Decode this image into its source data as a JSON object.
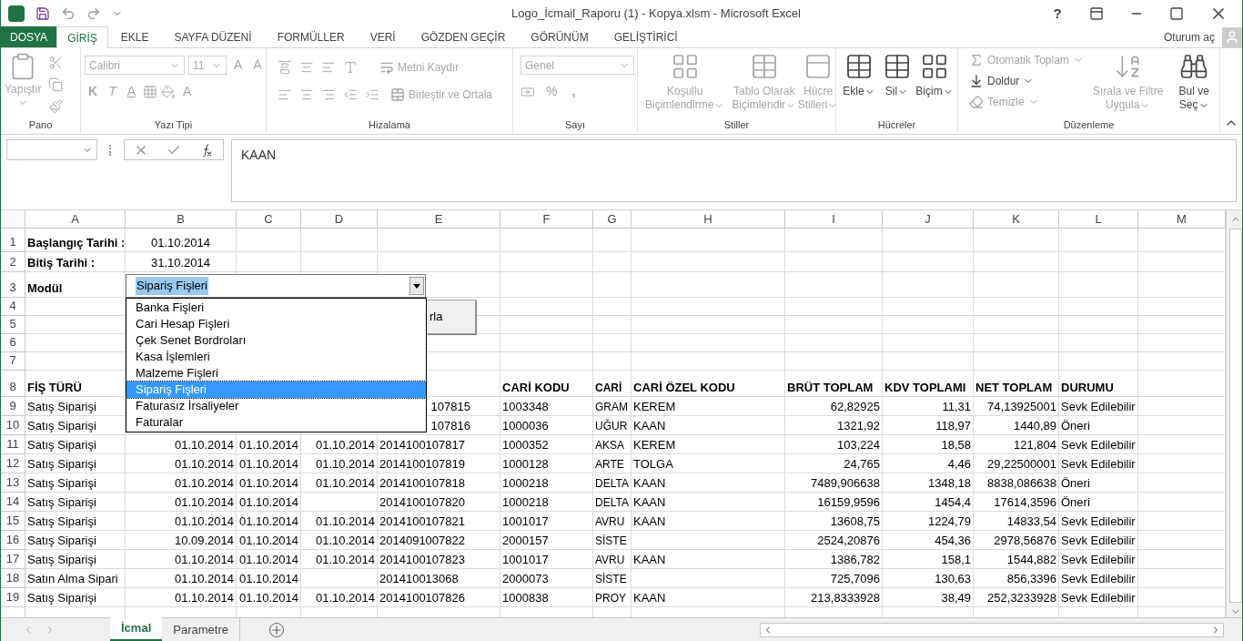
{
  "window": {
    "title": "Logo_İcmail_Raporu (1) - Kopya.xlsm - Microsoft Excel",
    "help": "?"
  },
  "ribbon_tabs": [
    {
      "label": "DOSYA",
      "kind": "file",
      "selected": false
    },
    {
      "label": "GİRİŞ",
      "kind": "tab",
      "selected": true
    },
    {
      "label": "EKLE",
      "kind": "tab",
      "selected": false
    },
    {
      "label": "SAYFA DÜZENİ",
      "kind": "tab",
      "selected": false
    },
    {
      "label": "FORMÜLLER",
      "kind": "tab",
      "selected": false
    },
    {
      "label": "VERİ",
      "kind": "tab",
      "selected": false
    },
    {
      "label": "GÖZDEN GEÇİR",
      "kind": "tab",
      "selected": false
    },
    {
      "label": "GÖRÜNÜM",
      "kind": "tab",
      "selected": false
    },
    {
      "label": "GELİŞTİRİCİ",
      "kind": "tab",
      "selected": false
    }
  ],
  "account": "Oturum aç",
  "ribbon": {
    "clipboard": {
      "name": "Pano",
      "paste": {
        "label": "Yapıştır",
        "disabled": true
      }
    },
    "font": {
      "name": "Yazı Tipi",
      "family": "Calibri",
      "size": "11",
      "grow": "A",
      "shrink": "A",
      "bold": "K",
      "italic": "T",
      "underline": "A",
      "text_color_button": "A",
      "disabled": true
    },
    "alignment": {
      "name": "Hizalama",
      "wrap": "Metni Kaydır",
      "merge": "Birleştir ve Ortala",
      "disabled": true
    },
    "number": {
      "name": "Sayı",
      "format": "Genel",
      "percent": "%",
      "comma": ",",
      "disabled": true
    },
    "styles": {
      "name": "Stiller",
      "items": [
        {
          "lines": [
            "Koşullu",
            "Biçimlendirme"
          ],
          "disabled": true
        },
        {
          "lines": [
            "Tablo Olarak",
            "Biçimlendir"
          ],
          "disabled": true
        },
        {
          "lines": [
            "Hücre",
            "Stilleri"
          ],
          "disabled": true
        }
      ]
    },
    "cells": {
      "name": "Hücreler",
      "items": [
        {
          "lines": [
            "Ekle"
          ],
          "disabled": false
        },
        {
          "lines": [
            "Sil"
          ],
          "disabled": false
        },
        {
          "lines": [
            "Biçim"
          ],
          "disabled": false
        }
      ]
    },
    "editing": {
      "name": "Düzenleme",
      "small": [
        {
          "label": "Otomatik Toplam",
          "disabled": true
        },
        {
          "label": "Doldur",
          "disabled": false
        },
        {
          "label": "Temizle",
          "disabled": true
        }
      ],
      "items": [
        {
          "lines": [
            "Sırala ve Filtre",
            "Uygula"
          ],
          "disabled": true
        },
        {
          "lines": [
            "Bul ve",
            "Seç"
          ],
          "disabled": false
        }
      ]
    }
  },
  "formula_bar": {
    "formula": "KAAN"
  },
  "columns": [
    "A",
    "B",
    "C",
    "D",
    "E",
    "F",
    "G",
    "H",
    "I",
    "J",
    "K",
    "L",
    "M"
  ],
  "rows": [
    {
      "number": "1",
      "kind": "form",
      "cells": {
        "A": "Başlangıç Tarihi :",
        "B": "01.10.2014"
      }
    },
    {
      "number": "2",
      "kind": "form",
      "cells": {
        "A": "Bitiş Tarihi :",
        "B": "31.10.2014"
      }
    },
    {
      "number": "3",
      "kind": "form",
      "cells": {
        "A": "Modül"
      }
    },
    {
      "number": "4",
      "kind": "data",
      "cells": {}
    },
    {
      "number": "5",
      "kind": "data",
      "cells": {}
    },
    {
      "number": "6",
      "kind": "data",
      "cells": {}
    },
    {
      "number": "7",
      "kind": "data",
      "cells": {}
    },
    {
      "number": "8",
      "kind": "heading",
      "cells": {
        "A": "FİŞ TÜRÜ",
        "F": "CARİ KODU",
        "G": "CARİ",
        "H": "CARİ ÖZEL KODU",
        "I": "BRÜT TOPLAM",
        "J": "KDV TOPLAMI",
        "K": "NET TOPLAM",
        "L": "DURUMU"
      }
    },
    {
      "number": "9",
      "kind": "covered",
      "cells": {
        "A": "Satış Siparişi",
        "E": "107815",
        "F": "1003348",
        "G": "GRAM",
        "H": "KEREM",
        "I": "62,82925",
        "J": "11,31",
        "K": "74,13925001",
        "L": "Sevk Edilebilir"
      }
    },
    {
      "number": "10",
      "kind": "covered",
      "cells": {
        "A": "Satış Siparişi",
        "E": "107816",
        "F": "1000036",
        "G": "UĞUR",
        "H": "KAAN",
        "I": "1321,92",
        "J": "118,97",
        "K": "1440,89",
        "L": "Öneri"
      }
    },
    {
      "number": "11",
      "kind": "data",
      "cells": {
        "A": "Satış Siparişi",
        "B": "01.10.2014",
        "C": "01.10.2014",
        "D": "01.10.2014",
        "E": "2014100107817",
        "F": "1000352",
        "G": "AKSA",
        "H": "KEREM",
        "I": "103,224",
        "J": "18,58",
        "K": "121,804",
        "L": "Sevk Edilebilir"
      }
    },
    {
      "number": "12",
      "kind": "data",
      "cells": {
        "A": "Satış Siparişi",
        "B": "01.10.2014",
        "C": "01.10.2014",
        "D": "01.10.2014",
        "E": "2014100107819",
        "F": "1000128",
        "G": "ARTE",
        "H": "TOLGA",
        "I": "24,765",
        "J": "4,46",
        "K": "29,22500001",
        "L": "Sevk Edilebilir"
      }
    },
    {
      "number": "13",
      "kind": "data",
      "cells": {
        "A": "Satış Siparişi",
        "B": "01.10.2014",
        "C": "01.10.2014",
        "D": "01.10.2014",
        "E": "2014100107818",
        "F": "1000218",
        "G": "DELTA",
        "H": "KAAN",
        "I": "7489,906638",
        "J": "1348,18",
        "K": "8838,086638",
        "L": "Öneri"
      }
    },
    {
      "number": "14",
      "kind": "data",
      "cells": {
        "A": "Satış Siparişi",
        "B": "01.10.2014",
        "C": "01.10.2014",
        "E": "2014100107820",
        "F": "1000218",
        "G": "DELTA",
        "H": "KAAN",
        "I": "16159,9596",
        "J": "1454,4",
        "K": "17614,3596",
        "L": "Öneri"
      }
    },
    {
      "number": "15",
      "kind": "data",
      "cells": {
        "A": "Satış Siparişi",
        "B": "01.10.2014",
        "C": "01.10.2014",
        "D": "01.10.2014",
        "E": "2014100107821",
        "F": "1001017",
        "G": "AVRU",
        "H": "KAAN",
        "I": "13608,75",
        "J": "1224,79",
        "K": "14833,54",
        "L": "Sevk Edilebilir"
      }
    },
    {
      "number": "16",
      "kind": "data",
      "cells": {
        "A": "Satış Siparişi",
        "B": "10.09.2014",
        "C": "01.10.2014",
        "D": "01.10.2014",
        "E": "2014091007822",
        "F": "2000157",
        "G": "SİSTE",
        "I": "2524,20876",
        "J": "454,36",
        "K": "2978,56876",
        "L": "Sevk Edilebilir"
      }
    },
    {
      "number": "17",
      "kind": "data",
      "cells": {
        "A": "Satış Siparişi",
        "B": "01.10.2014",
        "C": "01.10.2014",
        "D": "01.10.2014",
        "E": "2014100107823",
        "F": "1001017",
        "G": "AVRU",
        "H": "KAAN",
        "I": "1386,782",
        "J": "158,1",
        "K": "1544,882",
        "L": "Sevk Edilebilir"
      }
    },
    {
      "number": "18",
      "kind": "data",
      "cells": {
        "A": "Satın Alma Sipari",
        "B": "01.10.2014",
        "C": "01.10.2014",
        "E": "201410013068",
        "F": "2000073",
        "G": "SİSTE",
        "I": "725,7096",
        "J": "130,63",
        "K": "856,3396",
        "L": "Sevk Edilebilir"
      }
    },
    {
      "number": "19",
      "kind": "data",
      "cells": {
        "A": "Satış Siparişi",
        "B": "01.10.2014",
        "C": "01.10.2014",
        "D": "01.10.2014",
        "E": "2014100107826",
        "F": "1000838",
        "G": "PROY",
        "H": "KAAN",
        "I": "213,8333928",
        "J": "38,49",
        "K": "252,3233928",
        "L": "Sevk Edilebilir"
      }
    }
  ],
  "module_select": {
    "value": "Sipariş Fişleri",
    "options": [
      {
        "label": "Banka Fişleri",
        "selected": false
      },
      {
        "label": "Cari Hesap Fişleri",
        "selected": false
      },
      {
        "label": "Çek Senet Bordroları",
        "selected": false
      },
      {
        "label": "Kasa İşlemleri",
        "selected": false
      },
      {
        "label": "Malzeme Fişleri",
        "selected": false
      },
      {
        "label": "Sipariş Fişleri",
        "selected": true
      },
      {
        "label": "Faturasız İrsaliyeler",
        "selected": false
      },
      {
        "label": "Faturalar",
        "selected": false
      }
    ]
  },
  "sheet_button": {
    "label": "rla"
  },
  "sheet_tabs": [
    {
      "label": "İcmal",
      "selected": true
    },
    {
      "label": "Parametre",
      "selected": false
    }
  ]
}
